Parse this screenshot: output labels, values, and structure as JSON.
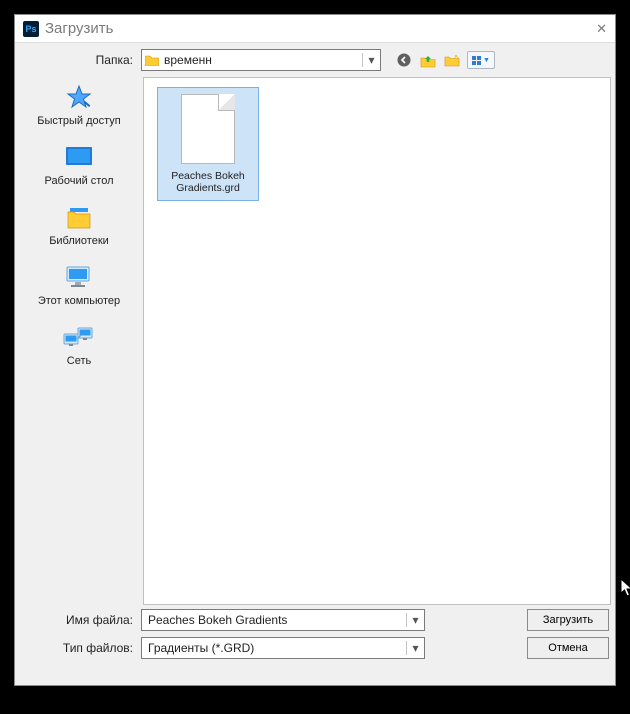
{
  "titlebar": {
    "title": "Загрузить",
    "app_icon_text": "Ps"
  },
  "topbar": {
    "folder_label": "Папка:",
    "folder_name": "временн"
  },
  "sidebar": {
    "items": [
      {
        "label": "Быстрый доступ"
      },
      {
        "label": "Рабочий стол"
      },
      {
        "label": "Библиотеки"
      },
      {
        "label": "Этот компьютер"
      },
      {
        "label": "Сеть"
      }
    ]
  },
  "filelist": {
    "items": [
      {
        "name": "Peaches Bokeh Gradients.grd",
        "selected": true
      }
    ]
  },
  "bottom": {
    "filename_label": "Имя файла:",
    "filename_value": "Peaches Bokeh Gradients",
    "filetype_label": "Тип файлов:",
    "filetype_value": "Градиенты (*.GRD)",
    "load_button": "Загрузить",
    "cancel_button": "Отмена"
  }
}
